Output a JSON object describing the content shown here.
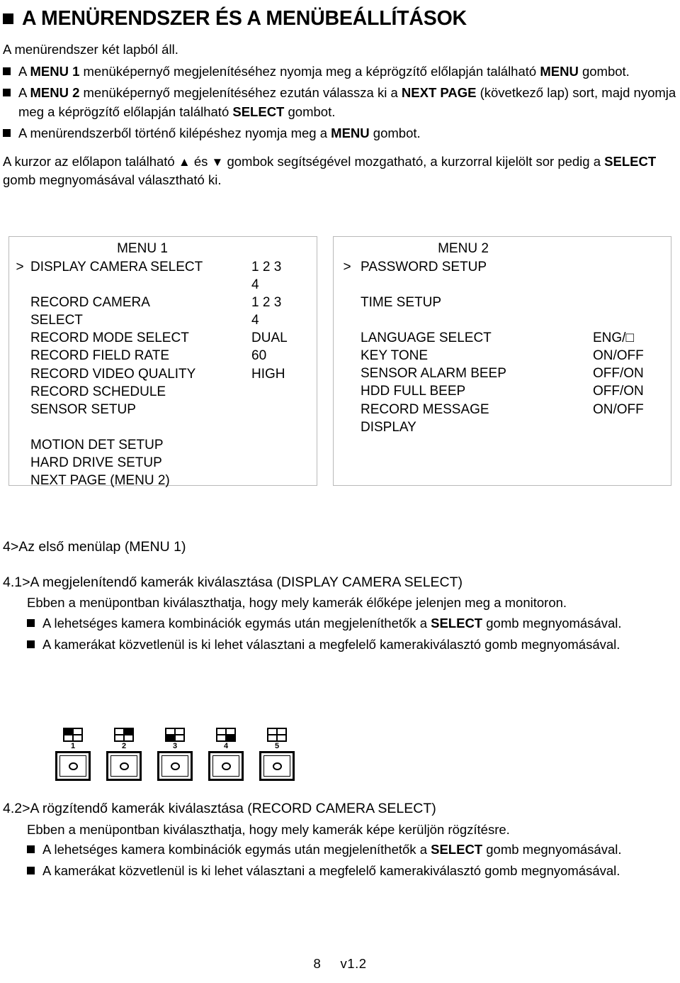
{
  "title": {
    "text": "A MENÜRENDSZER ÉS A MENÜBEÁLLÍTÁSOK",
    "bullet_icon": "filled-square-bullet"
  },
  "intro": {
    "lead": "A menürendszer két lapból áll.",
    "bullets": [
      {
        "parts": [
          {
            "t": "A ",
            "b": false
          },
          {
            "t": "MENU 1",
            "b": true
          },
          {
            "t": " menüképernyő megjelenítéséhez nyomja meg a képrögzítő előlapján található ",
            "b": false
          },
          {
            "t": "MENU",
            "b": true
          },
          {
            "t": " gombot.",
            "b": false
          }
        ]
      },
      {
        "parts": [
          {
            "t": "A ",
            "b": false
          },
          {
            "t": "MENU 2",
            "b": true
          },
          {
            "t": " menüképernyő megjelenítéséhez ezután válassza ki a ",
            "b": false
          },
          {
            "t": "NEXT PAGE",
            "b": true
          },
          {
            "t": " (következő lap) sort, majd nyomja meg a képrögzítő előlapján található ",
            "b": false
          },
          {
            "t": "SELECT",
            "b": true
          },
          {
            "t": " gombot.",
            "b": false
          }
        ]
      },
      {
        "parts": [
          {
            "t": "A menürendszerből történő kilépéshez nyomja meg a ",
            "b": false
          },
          {
            "t": "MENU",
            "b": true
          },
          {
            "t": " gombot.",
            "b": false
          }
        ]
      }
    ]
  },
  "cursor_para": {
    "parts": [
      {
        "t": "A kurzor az előlapon található ",
        "b": false
      },
      {
        "t": "▲",
        "b": false,
        "icon": "up-triangle-icon"
      },
      {
        "t": " és ",
        "b": false
      },
      {
        "t": "▼",
        "b": false,
        "icon": "down-triangle-icon"
      },
      {
        "t": " gombok segítségével mozgatható, a kurzorral kijelölt sor pedig a ",
        "b": false
      },
      {
        "t": "SELECT",
        "b": true
      },
      {
        "t": " gomb megnyomásával választható ki.",
        "b": false
      }
    ]
  },
  "menu1": {
    "heading": "MENU 1",
    "rows": [
      {
        "cursor": ">",
        "label": "DISPLAY CAMERA SELECT",
        "value": "1 2 3"
      },
      {
        "cursor": "",
        "label": "",
        "value": "4"
      },
      {
        "cursor": "",
        "label": "RECORD CAMERA",
        "value": "1 2 3"
      },
      {
        "cursor": "",
        "label": "SELECT",
        "value": "4"
      },
      {
        "cursor": "",
        "label": "RECORD MODE SELECT",
        "value": "DUAL"
      },
      {
        "cursor": "",
        "label": "RECORD FIELD RATE",
        "value": "60"
      },
      {
        "cursor": "",
        "label": "RECORD VIDEO QUALITY",
        "value": "HIGH"
      },
      {
        "cursor": "",
        "label": "RECORD SCHEDULE",
        "value": ""
      },
      {
        "cursor": "",
        "label": "SENSOR SETUP",
        "value": ""
      },
      {
        "cursor": "",
        "label": "",
        "value": ""
      },
      {
        "cursor": "",
        "label": "MOTION DET SETUP",
        "value": ""
      },
      {
        "cursor": "",
        "label": "HARD DRIVE SETUP",
        "value": ""
      },
      {
        "cursor": "",
        "label": "NEXT PAGE  (MENU 2)",
        "value": ""
      }
    ]
  },
  "menu2": {
    "heading": "MENU 2",
    "rows": [
      {
        "cursor": ">",
        "label": "PASSWORD SETUP",
        "value": ""
      },
      {
        "cursor": "",
        "label": "",
        "value": ""
      },
      {
        "cursor": "",
        "label": "TIME SETUP",
        "value": ""
      },
      {
        "cursor": "",
        "label": "",
        "value": ""
      },
      {
        "cursor": "",
        "label": "LANGUAGE SELECT",
        "value": "ENG/□"
      },
      {
        "cursor": "",
        "label": "KEY TONE",
        "value": "ON/OFF"
      },
      {
        "cursor": "",
        "label": "SENSOR ALARM BEEP",
        "value": "OFF/ON"
      },
      {
        "cursor": "",
        "label": "HDD FULL BEEP",
        "value": "OFF/ON"
      },
      {
        "cursor": "",
        "label": "RECORD MESSAGE",
        "value": "ON/OFF"
      },
      {
        "cursor": "",
        "label": "DISPLAY",
        "value": ""
      }
    ]
  },
  "section4": {
    "heading": "4>Az első menülap (MENU 1)",
    "sub_heading": "4.1>A megjelenítendő kamerák kiválasztása (DISPLAY CAMERA SELECT)",
    "body": "Ebben a menüpontban kiválaszthatja, hogy mely kamerák élőképe jelenjen meg a monitoron.",
    "bullets": [
      {
        "parts": [
          {
            "t": "A lehetséges kamera kombinációk egymás után megjeleníthetők a ",
            "b": false
          },
          {
            "t": "SELECT",
            "b": true
          },
          {
            "t": " gomb megnyomásával.",
            "b": false
          }
        ]
      },
      {
        "parts": [
          {
            "t": "A kamerákat közvetlenül is ki lehet választani a megfelelő kamerakiválasztó gomb megnyomásával.",
            "b": false
          }
        ]
      }
    ]
  },
  "camera_buttons": [
    {
      "number": "1",
      "quads": [
        true,
        false,
        false,
        false
      ]
    },
    {
      "number": "2",
      "quads": [
        false,
        true,
        false,
        false
      ]
    },
    {
      "number": "3",
      "quads": [
        false,
        false,
        true,
        false
      ]
    },
    {
      "number": "4",
      "quads": [
        false,
        false,
        false,
        true
      ]
    },
    {
      "number": "5",
      "quads": [
        false,
        false,
        false,
        false
      ]
    }
  ],
  "section42": {
    "heading": "4.2>A rögzítendő kamerák kiválasztása (RECORD CAMERA SELECT)",
    "body": "Ebben a menüpontban kiválaszthatja, hogy mely kamerák képe kerüljön rögzítésre.",
    "bullets": [
      {
        "parts": [
          {
            "t": "A lehetséges kamera kombinációk egymás után megjeleníthetők a ",
            "b": false
          },
          {
            "t": "SELECT",
            "b": true
          },
          {
            "t": " gomb megnyomásával.",
            "b": false
          }
        ]
      },
      {
        "parts": [
          {
            "t": "A kamerákat közvetlenül is ki lehet választani a megfelelő kamerakiválasztó gomb megnyomásával.",
            "b": false
          }
        ]
      }
    ]
  },
  "footer": {
    "page_number": "8",
    "version": "v1.2"
  }
}
